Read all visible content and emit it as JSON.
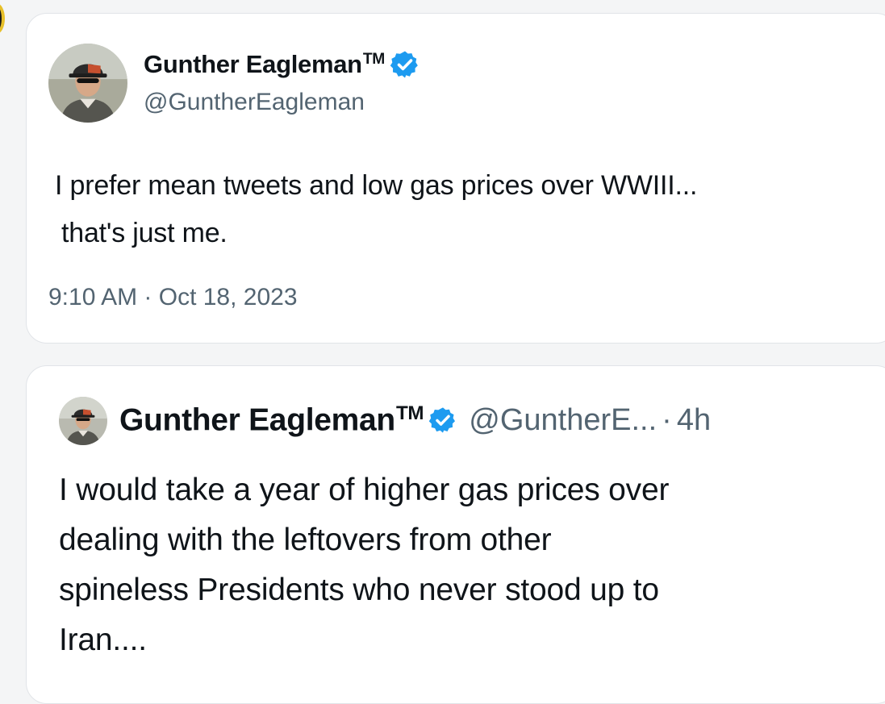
{
  "colors": {
    "verified_badge": "#1d9bf0",
    "secondary_text": "#536471",
    "primary_text": "#0f1419"
  },
  "original_tweet": {
    "display_name": "Gunther Eagleman",
    "trademark": "TM",
    "verified_icon": "verified-badge-icon",
    "handle": "@GuntherEagleman",
    "text_lines": [
      "I prefer mean tweets and low gas prices over WWIII...",
      "that's just me."
    ],
    "timestamp": "9:10 AM · Oct 18, 2023"
  },
  "recent_tweet": {
    "display_name": "Gunther Eagleman",
    "trademark": "TM",
    "verified_icon": "verified-badge-icon",
    "handle": "@GuntherE...",
    "separator": "·",
    "age": "4h",
    "text_lines": [
      "I would take a year of higher gas prices over",
      "dealing with the leftovers from other",
      "spineless Presidents who never stood up to",
      "Iran...."
    ]
  }
}
